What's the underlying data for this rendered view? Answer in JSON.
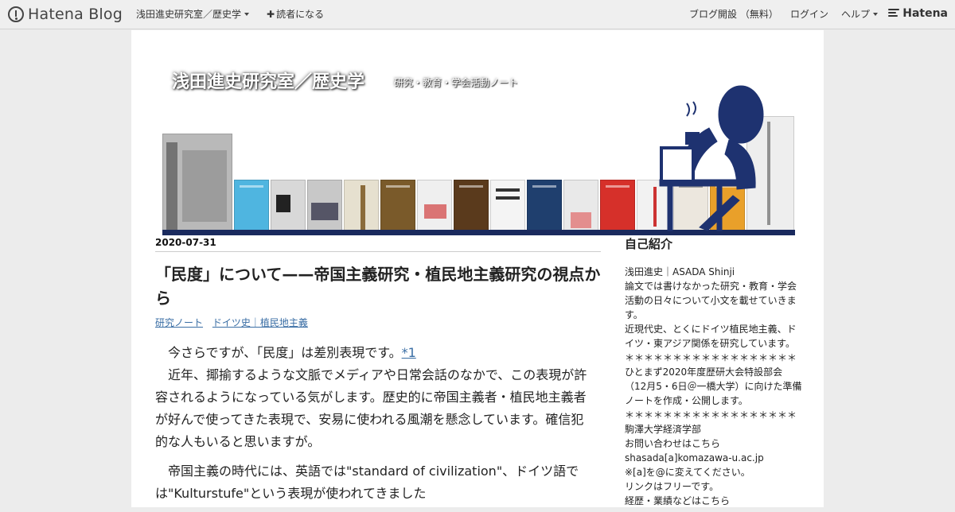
{
  "globalbar": {
    "logo_text": "Hatena Blog",
    "blog_menu": "浅田進史研究室／歴史学",
    "subscribe": "読者になる",
    "open_blog": "ブログ開設 （無料）",
    "login": "ログイン",
    "help": "ヘルプ",
    "hatena": "Hatena"
  },
  "blog": {
    "title": "浅田進史研究室／歴史学",
    "description": "研究・教育・学会活動ノート"
  },
  "entry": {
    "date": "2020-07-31",
    "title": "「民度」について——帝国主義研究・植民地主義研究の視点から",
    "categories": [
      "研究ノート",
      "ドイツ史｜植民地主義"
    ],
    "p1_a": "今さらですが、「民度」は差別表現です。",
    "p1_fn": "*1",
    "p1_b": "近年、揶揄するような文脈でメディアや日常会話のなかで、この表現が許容されるようになっている気がします。歴史的に帝国主義者・植民地主義者が好んで使ってきた表現で、安易に使われる風潮を懸念しています。確信犯的な人もいると思いますが。",
    "p2": "帝国主義の時代には、英語では\"standard of civilization\"、ドイツ語では\"Kulturstufe\"という表現が使われてきました"
  },
  "sidebar": {
    "heading": "自己紹介",
    "lines": [
      "浅田進史｜ASADA Shinji",
      "論文では書けなかった研究・教育・学会活動の日々について小文を載せていきます。",
      "近現代史、とくにドイツ植民地主義、ドイツ・東アジア関係を研究しています。",
      "＊＊＊＊＊＊＊＊＊＊＊＊＊＊＊＊＊＊",
      "ひとまず2020年度歴研大会特設部会（12月5・6日＠一橋大学）に向けた準備ノートを作成・公開します。",
      "＊＊＊＊＊＊＊＊＊＊＊＊＊＊＊＊＊＊",
      "駒澤大学経済学部",
      "お問い合わせはこちら",
      "shasada[a]komazawa-u.ac.jp",
      "※[a]を@に変えてください。",
      "リンクはフリーです。",
      "経歴・業績などはこちら"
    ]
  },
  "colors": {
    "banner_bar": "#1a2a5e",
    "link": "#3a6ea5",
    "illustration": "#1e3270"
  }
}
